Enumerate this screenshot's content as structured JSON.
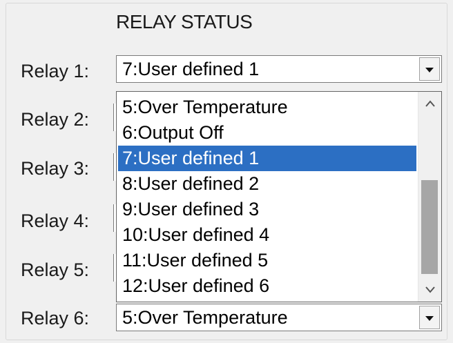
{
  "title": "RELAY STATUS",
  "relays": [
    {
      "label": "Relay 1:",
      "value": "7:User defined 1"
    },
    {
      "label": "Relay 2:",
      "value": ""
    },
    {
      "label": "Relay 3:",
      "value": ""
    },
    {
      "label": "Relay 4:",
      "value": ""
    },
    {
      "label": "Relay 5:",
      "value": ""
    },
    {
      "label": "Relay 6:",
      "value": "5:Over Temperature"
    }
  ],
  "dropdown": {
    "options": [
      "5:Over Temperature",
      "6:Output Off",
      "7:User defined 1",
      "8:User defined 2",
      "9:User defined 3",
      "10:User defined 4",
      "11:User defined 5",
      "12:User defined 6"
    ],
    "selected_option": "7:User defined 1",
    "icons": {
      "scroll_up": "chevron-up-icon",
      "scroll_down": "chevron-down-icon",
      "combo_arrow": "triangle-down-icon"
    }
  },
  "colors": {
    "selection": "#2c6fc3",
    "panel_background": "#f0f0f0",
    "scroll_thumb": "#a6a6a6"
  }
}
